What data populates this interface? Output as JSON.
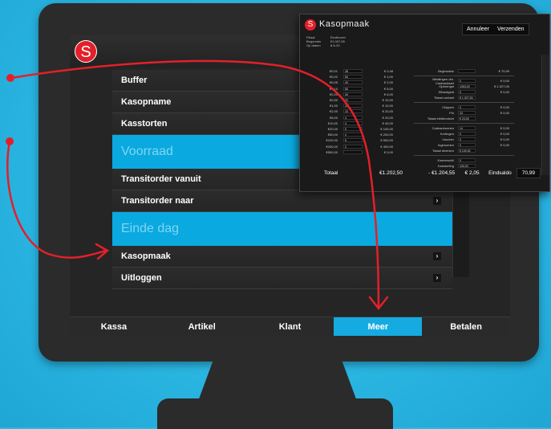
{
  "app": {
    "logo_letter": "S",
    "brand_color": "#e3202a",
    "accent_color": "#15abe1"
  },
  "menu": {
    "items": [
      {
        "label": "Buffer",
        "type": "item",
        "chevron": false
      },
      {
        "label": "Kasopname",
        "type": "item",
        "chevron": false
      },
      {
        "label": "Kasstorten",
        "type": "item",
        "chevron": false
      },
      {
        "label": "Voorraad",
        "type": "section",
        "chevron": false
      },
      {
        "label": "Transitorder vanuit",
        "type": "item",
        "chevron": false
      },
      {
        "label": "Transitorder naar",
        "type": "item",
        "chevron": true
      },
      {
        "label": "Einde dag",
        "type": "section",
        "chevron": false
      },
      {
        "label": "Kasopmaak",
        "type": "item",
        "chevron": true
      },
      {
        "label": "Uitloggen",
        "type": "item",
        "chevron": true
      }
    ]
  },
  "tabs": [
    {
      "label": "Kassa",
      "active": false
    },
    {
      "label": "Artikel",
      "active": false
    },
    {
      "label": "Klant",
      "active": false
    },
    {
      "label": "Meer",
      "active": true
    },
    {
      "label": "Betalen",
      "active": false
    }
  ],
  "dialog": {
    "title": "Kasopmaak",
    "cancel_label": "Annuleer",
    "send_label": "Verzenden",
    "meta": [
      {
        "k": "Filiaal",
        "v": "Eindhoven"
      },
      {
        "k": "Begonnen",
        "v": "€1.007,65"
      },
      {
        "k": "Op datum",
        "v": "8-6-20"
      }
    ],
    "denominations": [
      {
        "label": "€0,01",
        "count": "48",
        "total": "€ 0,48"
      },
      {
        "label": "€0,02",
        "count": "50",
        "total": "€ 1,00"
      },
      {
        "label": "€0,05",
        "count": "40",
        "total": "€ 2,00"
      },
      {
        "label": "€0,10",
        "count": "50",
        "total": "€ 5,00"
      },
      {
        "label": "€0,20",
        "count": "30",
        "total": "€ 6,00"
      },
      {
        "label": "€0,50",
        "count": "20",
        "total": "€ 10,00"
      },
      {
        "label": "€1,00",
        "count": "10",
        "total": "€ 10,00"
      },
      {
        "label": "€2,00",
        "count": "10",
        "total": "€ 20,00"
      },
      {
        "label": "€5,00",
        "count": "4",
        "total": "€ 20,00"
      },
      {
        "label": "€10,00",
        "count": "4",
        "total": "€ 40,00"
      },
      {
        "label": "€20,00",
        "count": "5",
        "total": "€ 100,00"
      },
      {
        "label": "€50,00",
        "count": "4",
        "total": "€ 200,00"
      },
      {
        "label": "€100,00",
        "count": "5",
        "total": "€ 500,00"
      },
      {
        "label": "€200,00",
        "count": "2",
        "total": "€ 400,00"
      },
      {
        "label": "€500,00",
        "count": "",
        "total": "€ 0,00"
      }
    ],
    "side_rows": [
      {
        "label": "Beginsaldo",
        "box": "",
        "value": "€ 70,99",
        "sep_after": true
      },
      {
        "label": "Betalingen dm. Cadeaukaart",
        "box": "0",
        "value": "€ 0,00",
        "sep_after": false
      },
      {
        "label": "Opbrengst",
        "box": "1053,00",
        "value": "€ 1.027,00",
        "sep_after": false
      },
      {
        "label": "Wisselgeld",
        "box": "0",
        "value": "€ 0,00",
        "sep_after": false
      },
      {
        "label": "Totaal contant",
        "box": "€ 1.027,53",
        "value": "",
        "sep_after": true
      },
      {
        "label": "Chippen",
        "box": "0",
        "value": "€ 0,00",
        "sep_after": false
      },
      {
        "label": "Pin",
        "box": "23",
        "value": "€ 0,00",
        "sep_after": false
      },
      {
        "label": "Totaal elektronisch",
        "box": "€ 23,00",
        "value": "",
        "sep_after": true
      },
      {
        "label": "Cadeaubonnen",
        "box": "14",
        "value": "€ 0,00",
        "sep_after": false
      },
      {
        "label": "Kortingen",
        "box": "0",
        "value": "€ 0,00",
        "sep_after": false
      },
      {
        "label": "Voucher",
        "box": "0",
        "value": "€ 0,00",
        "sep_after": false
      },
      {
        "label": "Ingenomen",
        "box": "0",
        "value": "€ 0,00",
        "sep_after": false
      },
      {
        "label": "Totaal diversen",
        "box": "€ 100,00",
        "value": "",
        "sep_after": true
      },
      {
        "label": "Kasverschil",
        "box": "0",
        "value": "",
        "sep_after": false
      },
      {
        "label": "Kasstorting",
        "box": "100,00",
        "value": "",
        "sep_after": false
      }
    ],
    "total_label": "Totaal",
    "total_value": "€1.202,50",
    "minus_value": "- €1.204,55",
    "diff_value": "€ 2,05",
    "end_label": "Eindsaldo",
    "end_value": "70,99"
  }
}
